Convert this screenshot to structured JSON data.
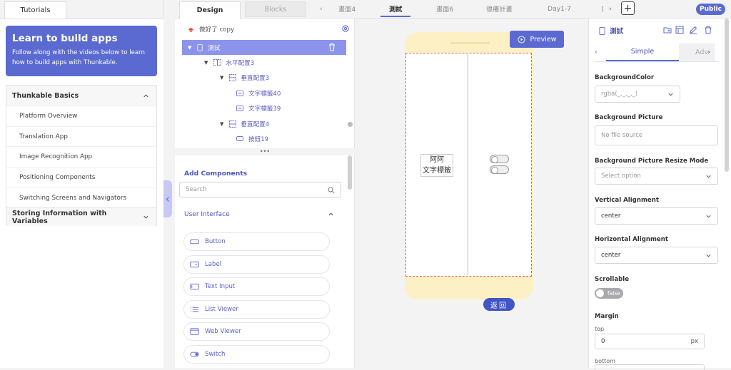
{
  "left_panel": {
    "tab": "Tutorials",
    "learn_title": "Learn to build apps",
    "learn_desc": "Follow along with the videos below to learn how to build apps with Thunkable.",
    "sections": [
      {
        "title": "Thunkable Basics",
        "items": [
          "Platform Overview",
          "Translation App",
          "Image Recognition App",
          "Positioning Components",
          "Switching Screens and Navigators"
        ]
      },
      {
        "title": "Storing Information with Variables"
      }
    ]
  },
  "topbar": {
    "design": "Design",
    "blocks": "Blocks",
    "screens": [
      "畫面4",
      "測試",
      "畫面6",
      "很癢計畫",
      "Day1-7"
    ],
    "public": "Public"
  },
  "tree": {
    "project": "做好了 copy",
    "items": [
      "測試",
      "水平配置3",
      "垂直配置3",
      "文字標籤40",
      "文字標籤39",
      "垂直配置4",
      "按鈕19"
    ]
  },
  "components": {
    "title": "Add Components",
    "search_placeholder": "Search",
    "section": "User Interface",
    "items": [
      "Button",
      "Label",
      "Text Input",
      "List Viewer",
      "Web Viewer",
      "Switch"
    ]
  },
  "canvas": {
    "preview": "Preview",
    "label_lines": [
      "阿阿",
      "文字標籤"
    ],
    "back": "返回"
  },
  "props": {
    "title": "測試",
    "tab_simple": "Simple",
    "tab_adv": "Adv",
    "bg_color_label": "BackgroundColor",
    "bg_color_value": "rgba(_,_,_,_)",
    "bg_picture_label": "Background Picture",
    "bg_picture_value": "No file source",
    "resize_label": "Background Picture Resize Mode",
    "resize_value": "Select option",
    "valign_label": "Vertical Alignment",
    "valign_value": "center",
    "halign_label": "Horizontal Alignment",
    "halign_value": "center",
    "scrollable_label": "Scrollable",
    "scrollable_value": "false",
    "margin_label": "Margin",
    "margin_top_label": "top",
    "margin_top_value": "0",
    "margin_unit": "px",
    "margin_bottom_label": "bottom"
  },
  "colors": {
    "accent": "#5b6ad0",
    "selection": "#8c93ea",
    "phone": "#fdf0c4",
    "outline": "#e8624a"
  }
}
